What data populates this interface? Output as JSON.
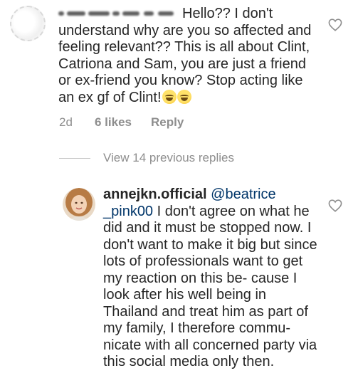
{
  "comment1": {
    "text": "Hello?? I don't understand why are you so affected and feeling relevant?? This is all about Clint, Catriona and Sam, you are just a friend or ex-friend you know? Stop acting like an ex gf of Clint!",
    "emojis": [
      "grinning-sweat-emoji",
      "grinning-sweat-emoji"
    ],
    "time": "2d",
    "likes": "6 likes",
    "reply_label": "Reply",
    "like_icon": "heart-outline-icon"
  },
  "view_replies": "View 14 previous replies",
  "comment2": {
    "username": "annejkn.official",
    "mention": "@beatrice _pink00",
    "text": "I don't agree on what he did and it must be stopped now. I don't want to make it big but since lots of professionals want to get my reaction on this be- cause I look after his well being in Thailand and treat him as part of my family, I therefore commu- nicate with all concerned party via this social media only then.",
    "like_icon": "heart-outline-icon"
  },
  "colors": {
    "text": "#262626",
    "meta": "#8e8e8e",
    "mention": "#003569"
  }
}
